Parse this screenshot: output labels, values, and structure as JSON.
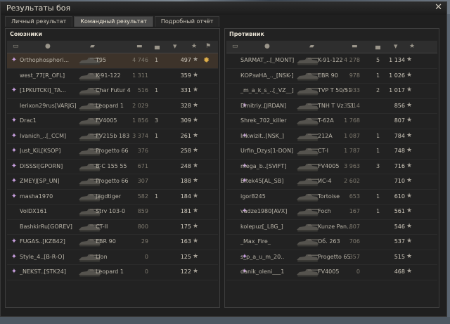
{
  "window": {
    "title": "Результаты боя",
    "close_icon": "close-icon"
  },
  "tabs": [
    {
      "label": "Личный результат",
      "active": false
    },
    {
      "label": "Командный результат",
      "active": true
    },
    {
      "label": "Подробный отчёт",
      "active": false
    }
  ],
  "allies": {
    "title": "Союзники",
    "header_icons": [
      "platoon-icon",
      "player-icon",
      "vehicle-icon",
      "damage-icon",
      "kills-icon",
      "sort-arrow-icon",
      "xp-star-icon",
      "medal-icon"
    ],
    "rows": [
      {
        "name": "Orthophosphori...",
        "vehicle": "T95",
        "damage": "4 746",
        "kills": "1",
        "xp": "497",
        "highlight": true,
        "badge": "clan-emblem-icon",
        "medal": true
      },
      {
        "name": "west_77[R_OFL]",
        "vehicle": "K-91-122",
        "damage": "1 311",
        "kills": "",
        "xp": "359",
        "highlight": false,
        "badge": "",
        "medal": false
      },
      {
        "name": "[1PKUTCKI]_TA...",
        "vehicle": "Char Futur 4",
        "damage": "516",
        "kills": "1",
        "xp": "331",
        "highlight": false,
        "badge": "clan-emblem-icon",
        "medal": false
      },
      {
        "name": "lerixon29rus[VARJG]",
        "vehicle": "Leopard 1",
        "damage": "2 029",
        "kills": "",
        "xp": "328",
        "highlight": false,
        "badge": "",
        "medal": false
      },
      {
        "name": "Drac1",
        "vehicle": "FV4005",
        "damage": "1 856",
        "kills": "3",
        "xp": "309",
        "highlight": false,
        "badge": "clan-emblem-icon",
        "medal": false
      },
      {
        "name": "Ivanich_..[_CCM]",
        "vehicle": "FV215b 183",
        "damage": "3 374",
        "kills": "1",
        "xp": "261",
        "highlight": false,
        "badge": "clan-emblem-icon",
        "medal": false
      },
      {
        "name": "Just_KiL[KSOP]",
        "vehicle": "Progetto 66",
        "damage": "376",
        "kills": "",
        "xp": "258",
        "highlight": false,
        "badge": "clan-emblem-icon",
        "medal": false
      },
      {
        "name": "DISSSI[GPORN]",
        "vehicle": "B-C 155 55",
        "damage": "671",
        "kills": "",
        "xp": "248",
        "highlight": false,
        "badge": "clan-emblem-icon",
        "medal": false
      },
      {
        "name": "ZMEYJ[SP_UN]",
        "vehicle": "Progetto 66",
        "damage": "307",
        "kills": "",
        "xp": "188",
        "highlight": false,
        "badge": "clan-emblem-icon",
        "medal": false
      },
      {
        "name": "masha1970",
        "vehicle": "Jagdtiger",
        "damage": "582",
        "kills": "1",
        "xp": "184",
        "highlight": false,
        "badge": "clan-emblem-icon",
        "medal": false
      },
      {
        "name": "VolDX161",
        "vehicle": "Strv 103-0",
        "damage": "859",
        "kills": "",
        "xp": "181",
        "highlight": false,
        "badge": "",
        "medal": false
      },
      {
        "name": "BashkirRu[GOREV]",
        "vehicle": "CT-II",
        "damage": "800",
        "kills": "",
        "xp": "175",
        "highlight": false,
        "badge": "",
        "medal": false
      },
      {
        "name": "FUGAS..[KZB42]",
        "vehicle": "EBR 90",
        "damage": "29",
        "kills": "",
        "xp": "163",
        "highlight": false,
        "badge": "clan-emblem-icon",
        "medal": false
      },
      {
        "name": "Style_4..[B-R-O]",
        "vehicle": "Lion",
        "damage": "0",
        "kills": "",
        "xp": "125",
        "highlight": false,
        "badge": "clan-emblem-icon",
        "medal": false
      },
      {
        "name": "_NEKST..[STK24]",
        "vehicle": "Leopard 1",
        "damage": "0",
        "kills": "",
        "xp": "122",
        "highlight": false,
        "badge": "clan-emblem-icon",
        "medal": false
      }
    ]
  },
  "enemies": {
    "title": "Противник",
    "header_icons": [
      "platoon-icon",
      "player-icon",
      "vehicle-icon",
      "damage-icon",
      "kills-icon",
      "sort-arrow-icon",
      "xp-star-icon"
    ],
    "rows": [
      {
        "name": "SARMAT_..[_MONT]",
        "vehicle": "K-91-122",
        "damage": "4 278",
        "kills": "5",
        "xp": "1 134",
        "badge": ""
      },
      {
        "name": "КОРзиНА_.._[NSK-]",
        "vehicle": "EBR 90",
        "damage": "978",
        "kills": "1",
        "xp": "1 026",
        "badge": ""
      },
      {
        "name": "_m_a_k_s_..[_VZ__]",
        "vehicle": "TVP T 50/51",
        "damage": "3 933",
        "kills": "2",
        "xp": "1 017",
        "badge": ""
      },
      {
        "name": "Dmitriy..[JRDAN]",
        "vehicle": "TNH T Vz. 51",
        "damage": "3 214",
        "kills": "",
        "xp": "856",
        "badge": "clan-emblem-icon"
      },
      {
        "name": "Shrek_702_killer",
        "vehicle": "T-62A",
        "damage": "1 768",
        "kills": "",
        "xp": "807",
        "badge": ""
      },
      {
        "name": "Inkwizit..[NSK_]",
        "vehicle": "212A",
        "damage": "1 087",
        "kills": "1",
        "xp": "784",
        "badge": "clan-emblem-icon"
      },
      {
        "name": "Urfin_Dzys[1-DON]",
        "vehicle": "CT-I",
        "damage": "1 787",
        "kills": "1",
        "xp": "748",
        "badge": ""
      },
      {
        "name": "mega_b..[SVIFT]",
        "vehicle": "FV4005",
        "damage": "3 963",
        "kills": "3",
        "xp": "716",
        "badge": "clan-emblem-icon"
      },
      {
        "name": "Bitek45[AL_SB]",
        "vehicle": "ИС-4",
        "damage": "2 602",
        "kills": "",
        "xp": "710",
        "badge": "clan-emblem-icon"
      },
      {
        "name": "igor8245",
        "vehicle": "Tortoise",
        "damage": "653",
        "kills": "1",
        "xp": "610",
        "badge": ""
      },
      {
        "name": "vadze1980[AVX]",
        "vehicle": "Foch",
        "damage": "167",
        "kills": "1",
        "xp": "561",
        "badge": "clan-emblem-icon"
      },
      {
        "name": "kolepuz[_L8G_]",
        "vehicle": "Kunze Pan...",
        "damage": "807",
        "kills": "",
        "xp": "546",
        "badge": ""
      },
      {
        "name": "_Max_Fire_",
        "vehicle": "Об. 263",
        "damage": "706",
        "kills": "",
        "xp": "537",
        "badge": ""
      },
      {
        "name": "s_p_a_u_m_20..",
        "vehicle": "Progetto 65",
        "damage": "357",
        "kills": "",
        "xp": "515",
        "badge": "clan-emblem-icon"
      },
      {
        "name": "danik_oleni___1",
        "vehicle": "FV4005",
        "damage": "0",
        "kills": "",
        "xp": "468",
        "badge": "clan-emblem-icon"
      }
    ]
  },
  "star_glyph": "★",
  "medal_glyph": "✹"
}
